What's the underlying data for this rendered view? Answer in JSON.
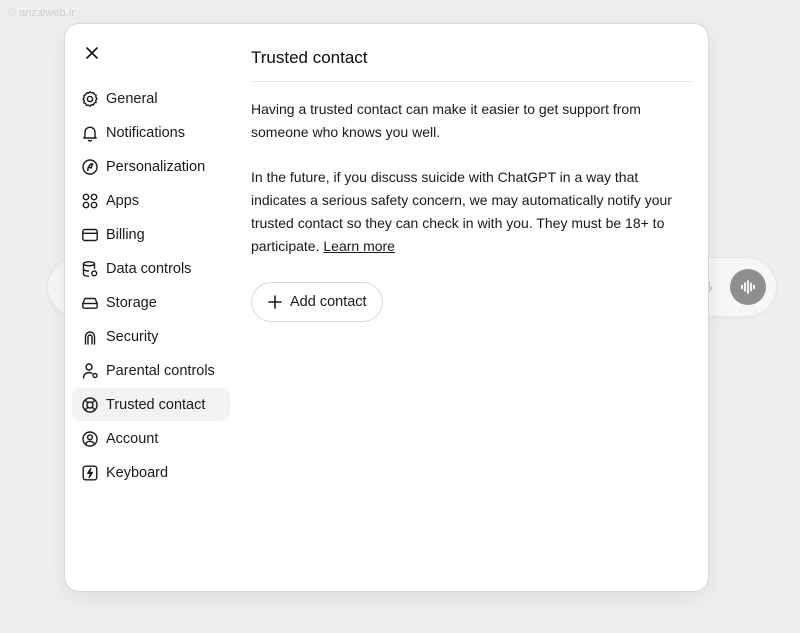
{
  "watermark": "© anzalweb.ir",
  "modal": {
    "close_icon": "close-icon",
    "title": "Trusted contact",
    "paragraph1": "Having a trusted contact can make it easier to get support from someone who knows you well.",
    "paragraph2": "In the future, if you discuss suicide with ChatGPT in a way that indicates a serious safety concern, we may automatically notify your trusted contact so they can check in with you. They must be 18+ to participate.",
    "learn_more": "Learn more",
    "add_contact_label": "Add contact",
    "add_contact_icon": "plus-icon"
  },
  "sidebar": {
    "items": [
      {
        "label": "General",
        "icon": "gear-icon",
        "active": false
      },
      {
        "label": "Notifications",
        "icon": "bell-icon",
        "active": false
      },
      {
        "label": "Personalization",
        "icon": "personalization-icon",
        "active": false
      },
      {
        "label": "Apps",
        "icon": "apps-icon",
        "active": false
      },
      {
        "label": "Billing",
        "icon": "credit-card-icon",
        "active": false
      },
      {
        "label": "Data controls",
        "icon": "database-icon",
        "active": false
      },
      {
        "label": "Storage",
        "icon": "storage-icon",
        "active": false
      },
      {
        "label": "Security",
        "icon": "security-icon",
        "active": false
      },
      {
        "label": "Parental controls",
        "icon": "parental-icon",
        "active": false
      },
      {
        "label": "Trusted contact",
        "icon": "lifebuoy-icon",
        "active": true
      },
      {
        "label": "Account",
        "icon": "account-icon",
        "active": false
      },
      {
        "label": "Keyboard",
        "icon": "keyboard-icon",
        "active": false
      }
    ]
  },
  "colors": {
    "background": "#efefef",
    "modal": "#ffffff",
    "active_item": "#f3f3f3",
    "voice_button": "#8f8f8f"
  },
  "background_composer": {
    "mic_icon": "microphone-icon",
    "voice_icon": "voice-waveform-icon"
  }
}
